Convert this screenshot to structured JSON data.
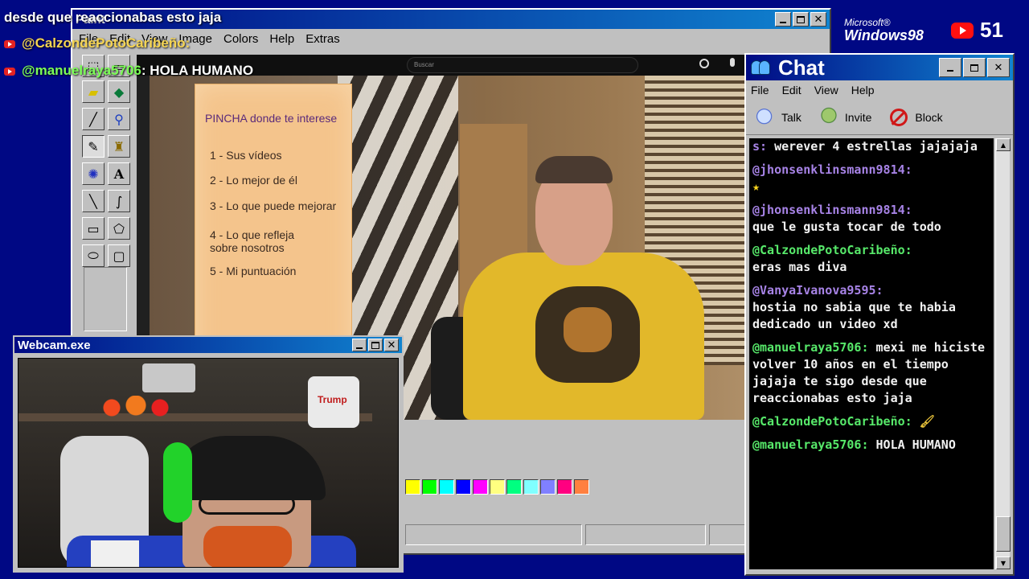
{
  "overlay": {
    "line1": "desde que reaccionabas esto jaja",
    "line2_user": "@CalzondePotoCaribeño:",
    "line3_user": "@manuelraya5706",
    "line3_text": ": HOLA HUMANO"
  },
  "paint": {
    "title": "Paint",
    "menu": [
      "File",
      "Edit",
      "View",
      "Image",
      "Colors",
      "Help",
      "Extras"
    ],
    "tools": [
      "free-select",
      "select",
      "eraser",
      "fill",
      "picker",
      "magnifier",
      "pencil",
      "brush",
      "airbrush",
      "text",
      "line",
      "curve",
      "rectangle",
      "polygon",
      "ellipse",
      "rounded-rect"
    ],
    "palette": [
      "#ffff00",
      "#00ff00",
      "#00ffff",
      "#0000ff",
      "#ff00ff",
      "#ffff80",
      "#00ff80",
      "#80ffff",
      "#8080ff",
      "#ff0080",
      "#ff8040"
    ]
  },
  "video": {
    "search_placeholder": "Buscar",
    "note": {
      "heading": "PINCHA donde te interese",
      "items": [
        "1 - Sus vídeos",
        "2 - Lo mejor de él",
        "3 - Lo que puede mejorar",
        "4 - Lo que refleja\n     sobre nosotros",
        "5 - Mi puntuación"
      ]
    }
  },
  "webcam": {
    "title": "Webcam.exe",
    "roll_text": "Trump"
  },
  "chat": {
    "title": "Chat",
    "menu": [
      "File",
      "Edit",
      "View",
      "Help"
    ],
    "tools": [
      "Talk",
      "Invite",
      "Block"
    ],
    "partial": {
      "user": "s:",
      "text": "werever 4 estrellas jajajaja"
    },
    "messages": [
      {
        "user": "@jhonsenklinsmann9814:",
        "text": "★",
        "user_color": "purple",
        "kind": "star"
      },
      {
        "user": "@jhonsenklinsmann9814:",
        "text": "que le gusta tocar de todo",
        "user_color": "purple",
        "kind": "text"
      },
      {
        "user": "@CalzondePotoCaribeño:",
        "text": "eras mas diva",
        "user_color": "green",
        "kind": "text"
      },
      {
        "user": "@VanyaIvanova9595:",
        "text": "hostia no sabia que te habia dedicado un video xd",
        "user_color": "purple",
        "kind": "text"
      },
      {
        "user": "@manuelraya5706:",
        "text": "mexi me hiciste volver 10 años en el tiempo jajaja te sigo desde que reaccionabas esto jaja",
        "user_color": "green",
        "kind": "text"
      },
      {
        "user": "@CalzondePotoCaribeño:",
        "text": "🖌",
        "user_color": "green",
        "kind": "brush"
      },
      {
        "user": "@manuelraya5706:",
        "text": "HOLA HUMANO",
        "user_color": "green",
        "kind": "text"
      }
    ]
  },
  "branding": {
    "ms": "Microsoft®",
    "windows": "Windows98",
    "viewers": "51"
  }
}
